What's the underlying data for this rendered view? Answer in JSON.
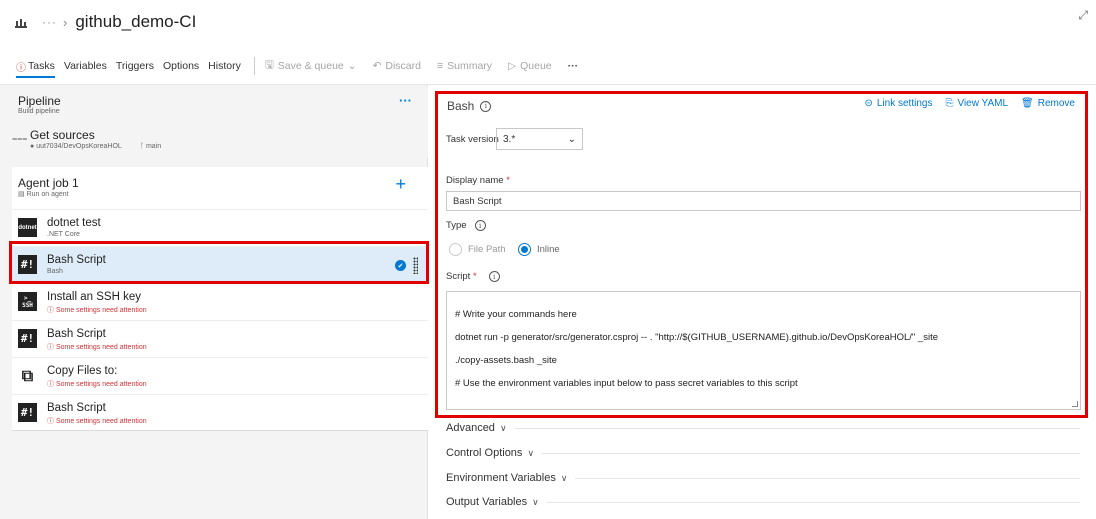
{
  "header": {
    "title": "github_demo-CI",
    "breadcrumb_more": "···"
  },
  "tabs": [
    {
      "label": "Tasks",
      "active": true
    },
    {
      "label": "Variables"
    },
    {
      "label": "Triggers"
    },
    {
      "label": "Options"
    },
    {
      "label": "History"
    }
  ],
  "commands": {
    "save_queue": "Save & queue",
    "discard": "Discard",
    "summary": "Summary",
    "queue": "Queue",
    "more": "···"
  },
  "pipeline": {
    "title": "Pipeline",
    "subtitle": "Build pipeline",
    "more": "···"
  },
  "get_sources": {
    "title": "Get sources",
    "repo": "uut7034/DevOpsKoreaHOL",
    "branch": "main"
  },
  "agent_job": {
    "title": "Agent job 1",
    "subtitle": "Run on agent",
    "add": "+"
  },
  "tasks": [
    {
      "name": "dotnet test",
      "subtitle": ".NET Core",
      "icon": "dotnet-icon",
      "icon_text": "dotnet",
      "error": false
    },
    {
      "name": "Bash Script",
      "subtitle": "Bash",
      "icon": "bash-icon",
      "icon_text": "#!",
      "error": false,
      "selected": true
    },
    {
      "name": "Install an SSH key",
      "subtitle": "Some settings need attention",
      "icon": "ssh-icon",
      "icon_text": ">_",
      "icon_sub": "SSH",
      "error": true
    },
    {
      "name": "Bash Script",
      "subtitle": "Some settings need attention",
      "icon": "bash-icon",
      "icon_text": "#!",
      "error": true
    },
    {
      "name": "Copy Files to:",
      "subtitle": "Some settings need attention",
      "icon": "copy-files-icon",
      "icon_text": "⧉",
      "error": true
    },
    {
      "name": "Bash Script",
      "subtitle": "Some settings need attention",
      "icon": "bash-icon",
      "icon_text": "#!",
      "error": true
    }
  ],
  "detail": {
    "title": "Bash",
    "link_settings": "Link settings",
    "view_yaml": "View YAML",
    "remove": "Remove",
    "task_version_label": "Task version",
    "task_version_value": "3.*",
    "display_name_label": "Display name",
    "display_name_value": "Bash Script",
    "type_label": "Type",
    "type_options": [
      "File Path",
      "Inline"
    ],
    "type_selected": "Inline",
    "script_label": "Script",
    "script_lines": [
      "# Write your commands here",
      "dotnet run -p generator/src/generator.csproj -- . \"http://$(GITHUB_USERNAME).github.io/DevOpsKoreaHOL/\" _site",
      "./copy-assets.bash _site",
      "# Use the environment variables input below to pass secret variables to this script"
    ]
  },
  "sections": [
    "Advanced",
    "Control Options",
    "Environment Variables",
    "Output Variables"
  ],
  "colors": {
    "accent": "#0078d4",
    "error": "#d13438",
    "highlight": "#e00000",
    "selected_bg": "#deecf9"
  }
}
